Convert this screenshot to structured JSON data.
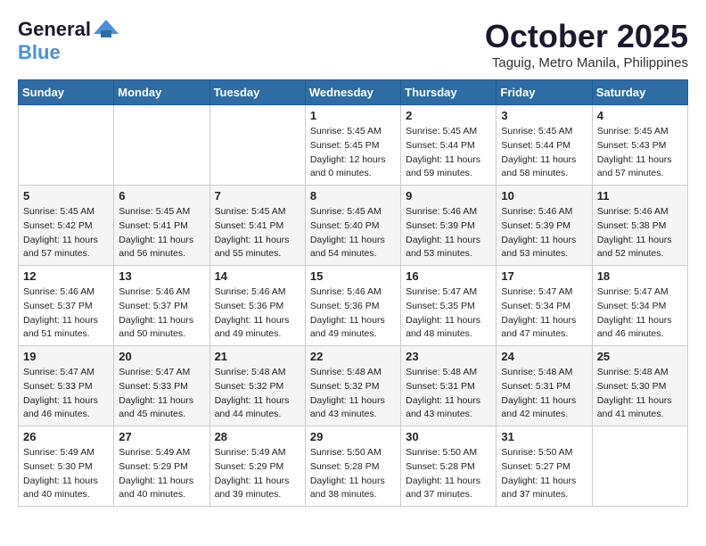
{
  "header": {
    "logo_general": "General",
    "logo_blue": "Blue",
    "month_title": "October 2025",
    "subtitle": "Taguig, Metro Manila, Philippines"
  },
  "calendar": {
    "days_of_week": [
      "Sunday",
      "Monday",
      "Tuesday",
      "Wednesday",
      "Thursday",
      "Friday",
      "Saturday"
    ],
    "weeks": [
      [
        {
          "day": "",
          "info": ""
        },
        {
          "day": "",
          "info": ""
        },
        {
          "day": "",
          "info": ""
        },
        {
          "day": "1",
          "info": "Sunrise: 5:45 AM\nSunset: 5:45 PM\nDaylight: 12 hours\nand 0 minutes."
        },
        {
          "day": "2",
          "info": "Sunrise: 5:45 AM\nSunset: 5:44 PM\nDaylight: 11 hours\nand 59 minutes."
        },
        {
          "day": "3",
          "info": "Sunrise: 5:45 AM\nSunset: 5:44 PM\nDaylight: 11 hours\nand 58 minutes."
        },
        {
          "day": "4",
          "info": "Sunrise: 5:45 AM\nSunset: 5:43 PM\nDaylight: 11 hours\nand 57 minutes."
        }
      ],
      [
        {
          "day": "5",
          "info": "Sunrise: 5:45 AM\nSunset: 5:42 PM\nDaylight: 11 hours\nand 57 minutes."
        },
        {
          "day": "6",
          "info": "Sunrise: 5:45 AM\nSunset: 5:41 PM\nDaylight: 11 hours\nand 56 minutes."
        },
        {
          "day": "7",
          "info": "Sunrise: 5:45 AM\nSunset: 5:41 PM\nDaylight: 11 hours\nand 55 minutes."
        },
        {
          "day": "8",
          "info": "Sunrise: 5:45 AM\nSunset: 5:40 PM\nDaylight: 11 hours\nand 54 minutes."
        },
        {
          "day": "9",
          "info": "Sunrise: 5:46 AM\nSunset: 5:39 PM\nDaylight: 11 hours\nand 53 minutes."
        },
        {
          "day": "10",
          "info": "Sunrise: 5:46 AM\nSunset: 5:39 PM\nDaylight: 11 hours\nand 53 minutes."
        },
        {
          "day": "11",
          "info": "Sunrise: 5:46 AM\nSunset: 5:38 PM\nDaylight: 11 hours\nand 52 minutes."
        }
      ],
      [
        {
          "day": "12",
          "info": "Sunrise: 5:46 AM\nSunset: 5:37 PM\nDaylight: 11 hours\nand 51 minutes."
        },
        {
          "day": "13",
          "info": "Sunrise: 5:46 AM\nSunset: 5:37 PM\nDaylight: 11 hours\nand 50 minutes."
        },
        {
          "day": "14",
          "info": "Sunrise: 5:46 AM\nSunset: 5:36 PM\nDaylight: 11 hours\nand 49 minutes."
        },
        {
          "day": "15",
          "info": "Sunrise: 5:46 AM\nSunset: 5:36 PM\nDaylight: 11 hours\nand 49 minutes."
        },
        {
          "day": "16",
          "info": "Sunrise: 5:47 AM\nSunset: 5:35 PM\nDaylight: 11 hours\nand 48 minutes."
        },
        {
          "day": "17",
          "info": "Sunrise: 5:47 AM\nSunset: 5:34 PM\nDaylight: 11 hours\nand 47 minutes."
        },
        {
          "day": "18",
          "info": "Sunrise: 5:47 AM\nSunset: 5:34 PM\nDaylight: 11 hours\nand 46 minutes."
        }
      ],
      [
        {
          "day": "19",
          "info": "Sunrise: 5:47 AM\nSunset: 5:33 PM\nDaylight: 11 hours\nand 46 minutes."
        },
        {
          "day": "20",
          "info": "Sunrise: 5:47 AM\nSunset: 5:33 PM\nDaylight: 11 hours\nand 45 minutes."
        },
        {
          "day": "21",
          "info": "Sunrise: 5:48 AM\nSunset: 5:32 PM\nDaylight: 11 hours\nand 44 minutes."
        },
        {
          "day": "22",
          "info": "Sunrise: 5:48 AM\nSunset: 5:32 PM\nDaylight: 11 hours\nand 43 minutes."
        },
        {
          "day": "23",
          "info": "Sunrise: 5:48 AM\nSunset: 5:31 PM\nDaylight: 11 hours\nand 43 minutes."
        },
        {
          "day": "24",
          "info": "Sunrise: 5:48 AM\nSunset: 5:31 PM\nDaylight: 11 hours\nand 42 minutes."
        },
        {
          "day": "25",
          "info": "Sunrise: 5:48 AM\nSunset: 5:30 PM\nDaylight: 11 hours\nand 41 minutes."
        }
      ],
      [
        {
          "day": "26",
          "info": "Sunrise: 5:49 AM\nSunset: 5:30 PM\nDaylight: 11 hours\nand 40 minutes."
        },
        {
          "day": "27",
          "info": "Sunrise: 5:49 AM\nSunset: 5:29 PM\nDaylight: 11 hours\nand 40 minutes."
        },
        {
          "day": "28",
          "info": "Sunrise: 5:49 AM\nSunset: 5:29 PM\nDaylight: 11 hours\nand 39 minutes."
        },
        {
          "day": "29",
          "info": "Sunrise: 5:50 AM\nSunset: 5:28 PM\nDaylight: 11 hours\nand 38 minutes."
        },
        {
          "day": "30",
          "info": "Sunrise: 5:50 AM\nSunset: 5:28 PM\nDaylight: 11 hours\nand 37 minutes."
        },
        {
          "day": "31",
          "info": "Sunrise: 5:50 AM\nSunset: 5:27 PM\nDaylight: 11 hours\nand 37 minutes."
        },
        {
          "day": "",
          "info": ""
        }
      ]
    ]
  }
}
